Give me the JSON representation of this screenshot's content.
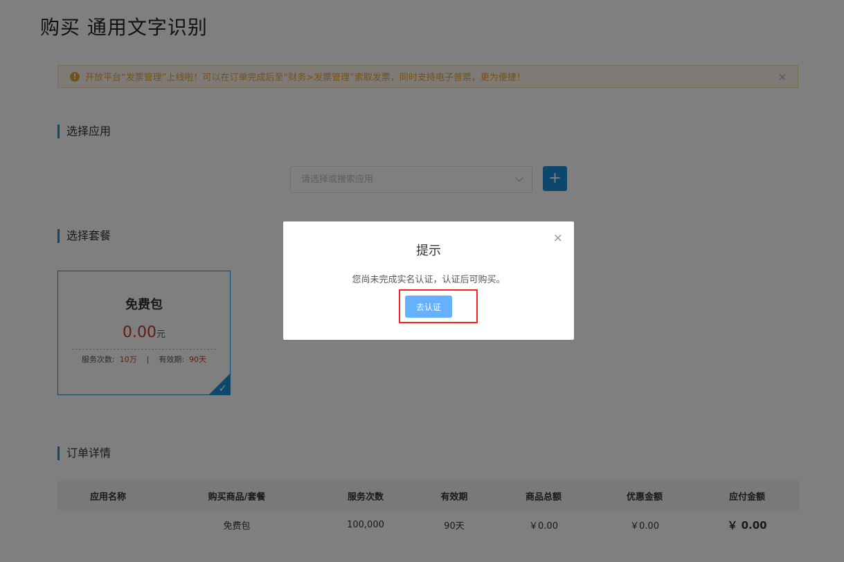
{
  "page_title": "购买 通用文字识别",
  "notice": {
    "icon": "warning-icon",
    "text": "开放平台“发票管理”上线啦！可以在订单完成后至“财务>发票管理”索取发票，同时支持电子普票，更为便捷！",
    "close": "×"
  },
  "sections": {
    "app": "选择应用",
    "plan": "选择套餐",
    "order": "订单详情"
  },
  "app_select": {
    "placeholder": "请选择或搜索应用",
    "add_label": "+"
  },
  "plan_card": {
    "name": "免费包",
    "price": "0.00",
    "unit": "元",
    "service_label": "服务次数:",
    "service_value": "10万",
    "divider": "|",
    "validity_label": "有效期:",
    "validity_value": "90天",
    "selected_mark": "✓"
  },
  "order_table": {
    "headers": [
      "应用名称",
      "购买商品/套餐",
      "服务次数",
      "有效期",
      "商品总额",
      "优惠金额",
      "应付金额"
    ],
    "row": [
      "",
      "免费包",
      "100,000",
      "90天",
      "￥0.00",
      "￥0.00",
      "￥ 0.00"
    ]
  },
  "dialog": {
    "title": "提示",
    "close": "×",
    "message": "您尚未完成实名认证，认证后可购买。",
    "button": "去认证"
  },
  "colors": {
    "accent": "#1a8fd6",
    "price_red": "#d9302a",
    "dialog_button": "#66b1ff",
    "highlight_box": "#ff1f1f",
    "notice_bg": "#fdf6ec",
    "notice_text": "#e6a23c"
  }
}
